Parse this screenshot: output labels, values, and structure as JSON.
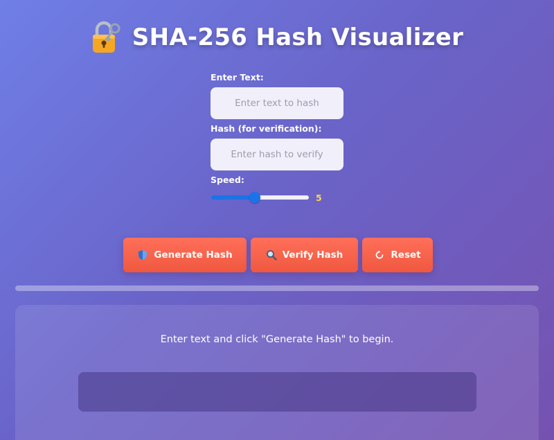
{
  "app": {
    "title": "SHA-256 Hash Visualizer"
  },
  "form": {
    "text_label": "Enter Text:",
    "text_placeholder": "Enter text to hash",
    "text_value": "",
    "hash_label": "Hash (for verification):",
    "hash_placeholder": "Enter hash to verify",
    "hash_value": "",
    "speed_label": "Speed:",
    "speed_value": "5",
    "speed_fraction": 0.45
  },
  "buttons": {
    "generate_label": "Generate Hash",
    "verify_label": "Verify Hash",
    "reset_label": "Reset"
  },
  "icons": {
    "title_icon": "lock-with-key-icon",
    "generate_icon": "shield-icon",
    "verify_icon": "magnifier-icon",
    "reset_icon": "refresh-icon"
  },
  "status": {
    "message": "Enter text and click \"Generate Hash\" to begin.",
    "progress": 0
  },
  "colors": {
    "accent_button": "#f0583f",
    "slider": "#1a73e8",
    "speed_value": "#ffd93d"
  }
}
